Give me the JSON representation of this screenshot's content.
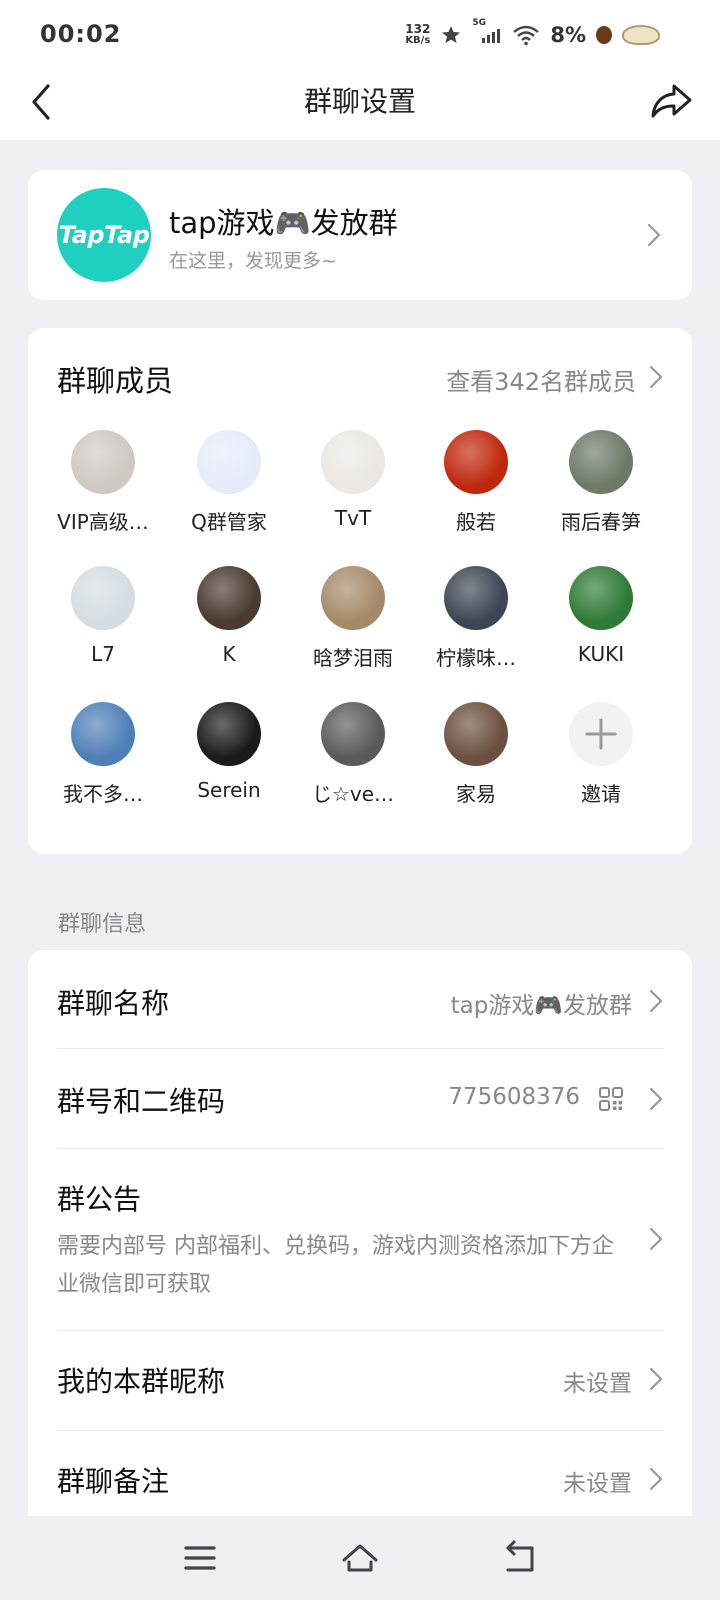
{
  "status": {
    "time": "00:02",
    "net_speed_value": "132",
    "net_speed_unit": "KB/s",
    "signal_label": "5G",
    "battery": "8%"
  },
  "nav": {
    "title": "群聊设置",
    "back_icon": "chevron-left-icon",
    "share_icon": "share-icon"
  },
  "group": {
    "avatar_text": "TapTap",
    "name": "tap游戏🎮发放群",
    "subtitle": "在这里，发现更多~"
  },
  "members": {
    "title": "群聊成员",
    "link": "查看342名群成员",
    "items": [
      {
        "name": "VIP高级…",
        "color": "#cfc9c4"
      },
      {
        "name": "Q群管家",
        "color": "#e6ebfa"
      },
      {
        "name": "TvT",
        "color": "#ece7e2"
      },
      {
        "name": "般若",
        "color": "#c0280e"
      },
      {
        "name": "雨后春笋",
        "color": "#6e7a68"
      },
      {
        "name": "L7",
        "color": "#d5dde2"
      },
      {
        "name": "K",
        "color": "#4a3a30"
      },
      {
        "name": "晗梦泪雨",
        "color": "#a58a6a"
      },
      {
        "name": "柠檬味…",
        "color": "#3d4654"
      },
      {
        "name": "KUKI",
        "color": "#2e7a36"
      },
      {
        "name": "我不多…",
        "color": "#4f7fb8"
      },
      {
        "name": "Serein",
        "color": "#1a1a1a"
      },
      {
        "name": "じ☆ve…",
        "color": "#5a5a5a"
      },
      {
        "name": "家易",
        "color": "#6b5040"
      },
      {
        "name": "邀请",
        "color": "#f2f2f2"
      }
    ]
  },
  "info": {
    "section_label": "群聊信息",
    "name_label": "群聊名称",
    "name_value": "tap游戏🎮发放群",
    "number_label": "群号和二维码",
    "number_value": "775608376",
    "notice_label": "群公告",
    "notice_text": "需要内部号 内部福利、兑换码，游戏内测资格添加下方企业微信即可获取",
    "nickname_label": "我的本群昵称",
    "nickname_value": "未设置",
    "remark_label": "群聊备注",
    "remark_value": "未设置"
  },
  "colors": {
    "accent_teal": "#1fd0c0",
    "page_bg": "#efeff4",
    "secondary_text": "#888888"
  }
}
